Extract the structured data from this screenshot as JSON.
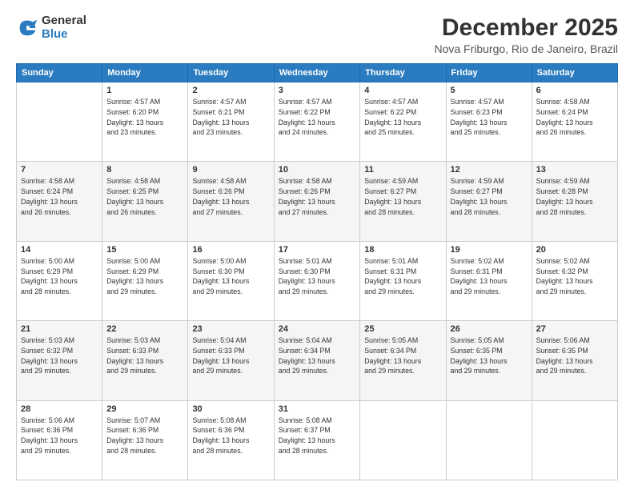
{
  "logo": {
    "general": "General",
    "blue": "Blue"
  },
  "title": "December 2025",
  "subtitle": "Nova Friburgo, Rio de Janeiro, Brazil",
  "weekdays": [
    "Sunday",
    "Monday",
    "Tuesday",
    "Wednesday",
    "Thursday",
    "Friday",
    "Saturday"
  ],
  "weeks": [
    [
      {
        "day": "",
        "info": ""
      },
      {
        "day": "1",
        "info": "Sunrise: 4:57 AM\nSunset: 6:20 PM\nDaylight: 13 hours\nand 23 minutes."
      },
      {
        "day": "2",
        "info": "Sunrise: 4:57 AM\nSunset: 6:21 PM\nDaylight: 13 hours\nand 23 minutes."
      },
      {
        "day": "3",
        "info": "Sunrise: 4:57 AM\nSunset: 6:22 PM\nDaylight: 13 hours\nand 24 minutes."
      },
      {
        "day": "4",
        "info": "Sunrise: 4:57 AM\nSunset: 6:22 PM\nDaylight: 13 hours\nand 25 minutes."
      },
      {
        "day": "5",
        "info": "Sunrise: 4:57 AM\nSunset: 6:23 PM\nDaylight: 13 hours\nand 25 minutes."
      },
      {
        "day": "6",
        "info": "Sunrise: 4:58 AM\nSunset: 6:24 PM\nDaylight: 13 hours\nand 26 minutes."
      }
    ],
    [
      {
        "day": "7",
        "info": "Sunrise: 4:58 AM\nSunset: 6:24 PM\nDaylight: 13 hours\nand 26 minutes."
      },
      {
        "day": "8",
        "info": "Sunrise: 4:58 AM\nSunset: 6:25 PM\nDaylight: 13 hours\nand 26 minutes."
      },
      {
        "day": "9",
        "info": "Sunrise: 4:58 AM\nSunset: 6:26 PM\nDaylight: 13 hours\nand 27 minutes."
      },
      {
        "day": "10",
        "info": "Sunrise: 4:58 AM\nSunset: 6:26 PM\nDaylight: 13 hours\nand 27 minutes."
      },
      {
        "day": "11",
        "info": "Sunrise: 4:59 AM\nSunset: 6:27 PM\nDaylight: 13 hours\nand 28 minutes."
      },
      {
        "day": "12",
        "info": "Sunrise: 4:59 AM\nSunset: 6:27 PM\nDaylight: 13 hours\nand 28 minutes."
      },
      {
        "day": "13",
        "info": "Sunrise: 4:59 AM\nSunset: 6:28 PM\nDaylight: 13 hours\nand 28 minutes."
      }
    ],
    [
      {
        "day": "14",
        "info": "Sunrise: 5:00 AM\nSunset: 6:29 PM\nDaylight: 13 hours\nand 28 minutes."
      },
      {
        "day": "15",
        "info": "Sunrise: 5:00 AM\nSunset: 6:29 PM\nDaylight: 13 hours\nand 29 minutes."
      },
      {
        "day": "16",
        "info": "Sunrise: 5:00 AM\nSunset: 6:30 PM\nDaylight: 13 hours\nand 29 minutes."
      },
      {
        "day": "17",
        "info": "Sunrise: 5:01 AM\nSunset: 6:30 PM\nDaylight: 13 hours\nand 29 minutes."
      },
      {
        "day": "18",
        "info": "Sunrise: 5:01 AM\nSunset: 6:31 PM\nDaylight: 13 hours\nand 29 minutes."
      },
      {
        "day": "19",
        "info": "Sunrise: 5:02 AM\nSunset: 6:31 PM\nDaylight: 13 hours\nand 29 minutes."
      },
      {
        "day": "20",
        "info": "Sunrise: 5:02 AM\nSunset: 6:32 PM\nDaylight: 13 hours\nand 29 minutes."
      }
    ],
    [
      {
        "day": "21",
        "info": "Sunrise: 5:03 AM\nSunset: 6:32 PM\nDaylight: 13 hours\nand 29 minutes."
      },
      {
        "day": "22",
        "info": "Sunrise: 5:03 AM\nSunset: 6:33 PM\nDaylight: 13 hours\nand 29 minutes."
      },
      {
        "day": "23",
        "info": "Sunrise: 5:04 AM\nSunset: 6:33 PM\nDaylight: 13 hours\nand 29 minutes."
      },
      {
        "day": "24",
        "info": "Sunrise: 5:04 AM\nSunset: 6:34 PM\nDaylight: 13 hours\nand 29 minutes."
      },
      {
        "day": "25",
        "info": "Sunrise: 5:05 AM\nSunset: 6:34 PM\nDaylight: 13 hours\nand 29 minutes."
      },
      {
        "day": "26",
        "info": "Sunrise: 5:05 AM\nSunset: 6:35 PM\nDaylight: 13 hours\nand 29 minutes."
      },
      {
        "day": "27",
        "info": "Sunrise: 5:06 AM\nSunset: 6:35 PM\nDaylight: 13 hours\nand 29 minutes."
      }
    ],
    [
      {
        "day": "28",
        "info": "Sunrise: 5:06 AM\nSunset: 6:36 PM\nDaylight: 13 hours\nand 29 minutes."
      },
      {
        "day": "29",
        "info": "Sunrise: 5:07 AM\nSunset: 6:36 PM\nDaylight: 13 hours\nand 28 minutes."
      },
      {
        "day": "30",
        "info": "Sunrise: 5:08 AM\nSunset: 6:36 PM\nDaylight: 13 hours\nand 28 minutes."
      },
      {
        "day": "31",
        "info": "Sunrise: 5:08 AM\nSunset: 6:37 PM\nDaylight: 13 hours\nand 28 minutes."
      },
      {
        "day": "",
        "info": ""
      },
      {
        "day": "",
        "info": ""
      },
      {
        "day": "",
        "info": ""
      }
    ]
  ]
}
